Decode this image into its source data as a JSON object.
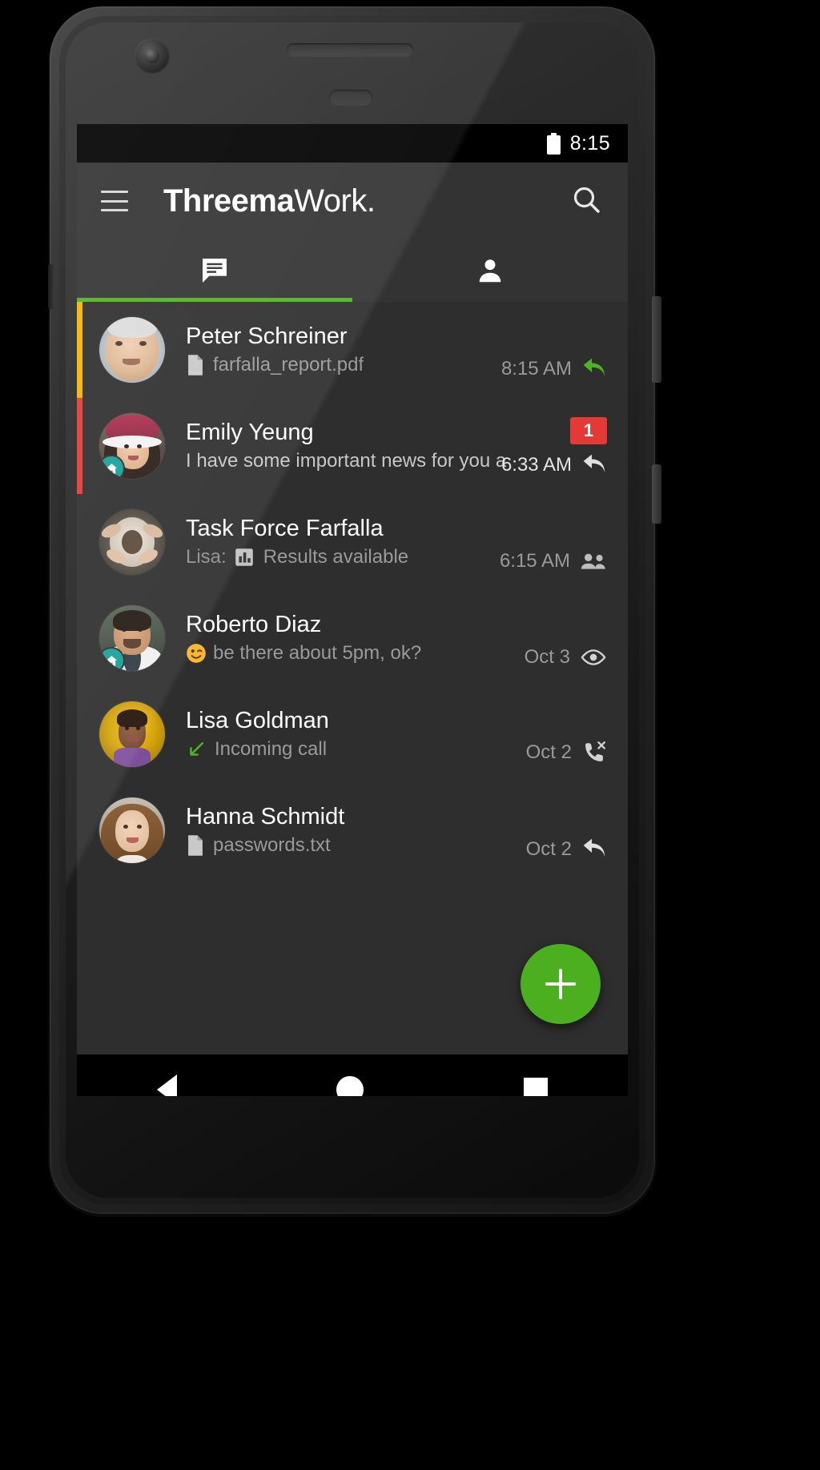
{
  "device": {
    "platform": "android-phone-mockup"
  },
  "status_bar": {
    "time": "8:15",
    "battery_icon": "battery-full-icon"
  },
  "toolbar": {
    "menu_icon": "hamburger-menu-icon",
    "brand_bold": "Threema",
    "brand_light": "Work.",
    "search_icon": "search-icon"
  },
  "tabs": {
    "active_index": 0,
    "accent_color": "#4eb522",
    "items": [
      {
        "name": "chats-tab",
        "icon": "chat-bubble-icon"
      },
      {
        "name": "contacts-tab",
        "icon": "person-icon"
      }
    ]
  },
  "chats": [
    {
      "name": "Peter Schreiner",
      "preview_icon": "file-document-icon",
      "preview": "farfalla_report.pdf",
      "time": "8:15 AM",
      "status_icon": "reply-arrow-green-icon",
      "flag_color": "#f5b400",
      "unread": "",
      "work_badge": false
    },
    {
      "name": "Emily Yeung",
      "preview_icon": "",
      "preview": "I have some important news for you a",
      "time": "6:33 AM",
      "status_icon": "reply-arrow-icon",
      "flag_color": "#e53935",
      "unread": "1",
      "work_badge": true
    },
    {
      "name": "Task Force Farfalla",
      "preview_icon": "poll-bar-chart-icon",
      "preview": "Results available",
      "preview_prefix": "Lisa:",
      "time": "6:15 AM",
      "status_icon": "group-people-icon",
      "flag_color": "",
      "unread": "",
      "work_badge": false
    },
    {
      "name": "Roberto Diaz",
      "preview_icon": "wink-emoji-icon",
      "preview": "be there about 5pm, ok?",
      "time": "Oct 3",
      "status_icon": "eye-read-icon",
      "flag_color": "",
      "unread": "",
      "work_badge": true
    },
    {
      "name": "Lisa Goldman",
      "preview_icon": "incoming-call-arrow-icon",
      "preview": "Incoming call",
      "time": "Oct 2",
      "status_icon": "phone-missed-icon",
      "flag_color": "",
      "unread": "",
      "work_badge": false
    },
    {
      "name": "Hanna Schmidt",
      "preview_icon": "file-document-icon",
      "preview": "passwords.txt",
      "time": "Oct 2",
      "status_icon": "reply-arrow-icon",
      "flag_color": "",
      "unread": "",
      "work_badge": false
    }
  ],
  "fab": {
    "label": "+",
    "name": "new-chat-fab",
    "color": "#4caf1f"
  },
  "nav_bar": {
    "back": "back-triangle-icon",
    "home": "home-circle-icon",
    "recents": "recents-square-icon"
  }
}
